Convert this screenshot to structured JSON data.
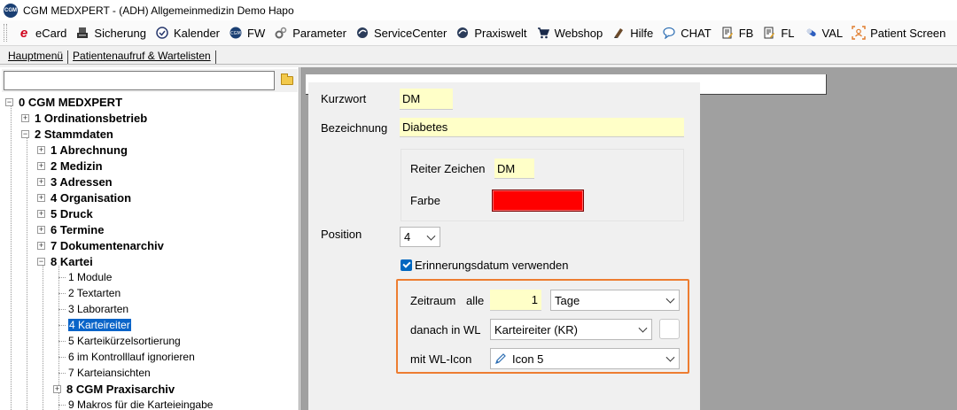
{
  "window": {
    "icon_text": "CGM",
    "title": "CGM MEDXPERT - (ADH) Allgemeinmedizin Demo Hapo"
  },
  "toolbar": [
    {
      "label": "eCard",
      "icon": "ecard-icon"
    },
    {
      "label": "Sicherung",
      "icon": "backup-icon"
    },
    {
      "label": "Kalender",
      "icon": "calendar-icon"
    },
    {
      "label": "FW",
      "icon": "fw-icon"
    },
    {
      "label": "Parameter",
      "icon": "parameter-icon"
    },
    {
      "label": "ServiceCenter",
      "icon": "service-center-icon"
    },
    {
      "label": "Praxiswelt",
      "icon": "praxiswelt-icon"
    },
    {
      "label": "Webshop",
      "icon": "cart-icon"
    },
    {
      "label": "Hilfe",
      "icon": "help-icon"
    },
    {
      "label": "CHAT",
      "icon": "chat-icon"
    },
    {
      "label": "FB",
      "icon": "form-fb-icon"
    },
    {
      "label": "FL",
      "icon": "form-fl-icon"
    },
    {
      "label": "VAL",
      "icon": "val-icon"
    },
    {
      "label": "Patient Screen",
      "icon": "patient-screen-icon"
    }
  ],
  "tabs": [
    {
      "label": "Hauptmenü"
    },
    {
      "label": "Patientenaufruf & Wartelisten"
    }
  ],
  "search": {
    "value": ""
  },
  "tree": {
    "root": "0 CGM MEDXPERT",
    "items": [
      {
        "label": "1 Ordinationsbetrieb",
        "expander": "+"
      },
      {
        "label": "2 Stammdaten",
        "expander": "−"
      },
      {
        "label": "1 Abrechnung",
        "expander": "+"
      },
      {
        "label": "2 Medizin",
        "expander": "+"
      },
      {
        "label": "3 Adressen",
        "expander": "+"
      },
      {
        "label": "4 Organisation",
        "expander": "+"
      },
      {
        "label": "5 Druck",
        "expander": "+"
      },
      {
        "label": "6 Termine",
        "expander": "+"
      },
      {
        "label": "7 Dokumentenarchiv",
        "expander": "+"
      },
      {
        "label": "8 Kartei",
        "expander": "−"
      },
      {
        "label": "1 Module"
      },
      {
        "label": "2 Textarten"
      },
      {
        "label": "3 Laborarten"
      },
      {
        "label": "4 Karteireiter",
        "selected": true
      },
      {
        "label": "5 Karteikürzelsortierung"
      },
      {
        "label": "6 im Kontrolllauf ignorieren"
      },
      {
        "label": "7 Karteiansichten"
      },
      {
        "label": "8 CGM Praxisarchiv",
        "expander": "+"
      },
      {
        "label": "9 Makros für die Karteieingabe"
      }
    ]
  },
  "form": {
    "kurzwort_label": "Kurzwort",
    "kurzwort_value": "DM",
    "bezeichnung_label": "Bezeichnung",
    "bezeichnung_value": "Diabetes",
    "reiter_zeichen_label": "Reiter Zeichen",
    "reiter_zeichen_value": "DM",
    "farbe_label": "Farbe",
    "farbe_color": "#ff0000",
    "position_label": "Position",
    "position_value": "4",
    "erinnerung_label": "Erinnerungsdatum verwenden",
    "erinnerung_checked": true,
    "zeitraum_label": "Zeitraum",
    "alle_label": "alle",
    "zeitraum_value": "1",
    "zeitraum_unit": "Tage",
    "danach_label": "danach in WL",
    "danach_value": "Karteireiter (KR)",
    "wl_icon_label": "mit WL-Icon",
    "wl_icon_value": "Icon 5"
  },
  "colors": {
    "highlight_border": "#ed7d31",
    "input_background": "#ffffc8",
    "selection": "#0a64c8"
  }
}
